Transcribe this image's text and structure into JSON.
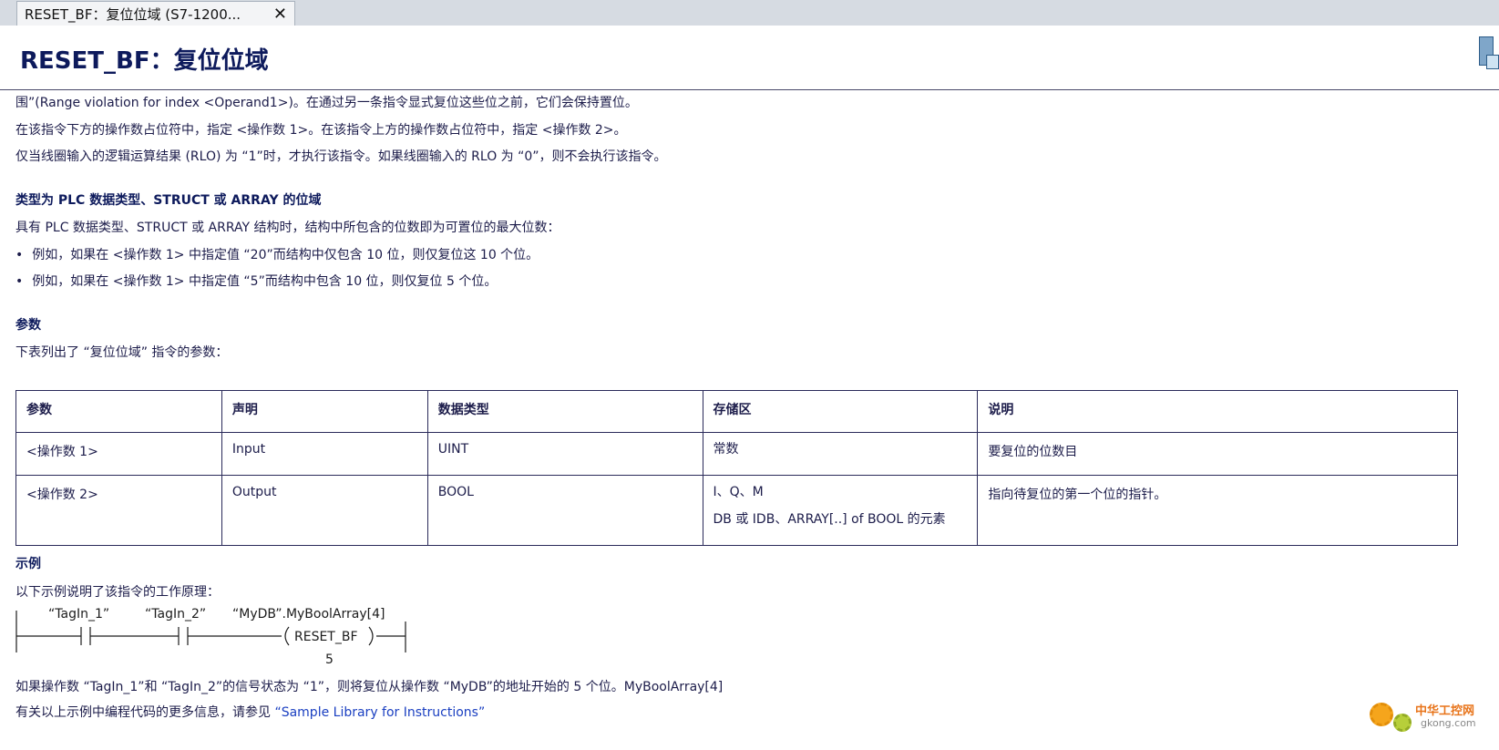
{
  "tab": {
    "label": "RESET_BF：复位位域 (S7-1200...",
    "close": "✕"
  },
  "page_title": "RESET_BF：复位位域",
  "intro_lines": [
    "围”(Range violation for index <Operand1>)。在通过另一条指令显式复位这些位之前，它们会保持置位。",
    "在该指令下方的操作数占位符中，指定 <操作数 1>。在该指令上方的操作数占位符中，指定 <操作数 2>。",
    "仅当线圈输入的逻辑运算结果 (RLO) 为 “1”时，才执行该指令。如果线圈输入的 RLO 为 “0”，则不会执行该指令。"
  ],
  "section_struct": {
    "heading": "类型为 PLC 数据类型、STRUCT 或 ARRAY 的位域",
    "text": "具有 PLC 数据类型、STRUCT 或 ARRAY 结构时，结构中所包含的位数即为可置位的最大位数：",
    "bullets": [
      "例如，如果在 <操作数 1> 中指定值 “20”而结构中仅包含 10 位，则仅复位这 10 个位。",
      "例如，如果在 <操作数 1> 中指定值 “5”而结构中包含 10 位，则仅复位 5 个位。"
    ]
  },
  "section_params": {
    "heading": "参数",
    "text": "下表列出了 “复位位域” 指令的参数："
  },
  "params_table": {
    "headers": [
      "参数",
      "声明",
      "数据类型",
      "存储区",
      "说明"
    ],
    "rows": [
      {
        "param": "<操作数 1>",
        "decl": "Input",
        "type": "UINT",
        "area": [
          "常数"
        ],
        "desc": "要复位的位数目"
      },
      {
        "param": "<操作数 2>",
        "decl": "Output",
        "type": "BOOL",
        "area": [
          "I、Q、M",
          "DB 或 IDB、ARRAY[..] of BOOL 的元素"
        ],
        "desc": "指向待复位的第一个位的指针。"
      }
    ]
  },
  "section_example": {
    "heading": "示例",
    "text": "以下示例说明了该指令的工作原理：",
    "ladder": {
      "contact1": "“TagIn_1”",
      "contact2": "“TagIn_2”",
      "coil_operand": "“MyDB”.MyBoolArray[4]",
      "coil_label": "RESET_BF",
      "count": "5"
    },
    "result_text": "如果操作数 “TagIn_1”和 “TagIn_2”的信号状态为 “1”，则将复位从操作数 “MyDB”的地址开始的 5 个位。MyBoolArray[4]",
    "more_info_prefix": "有关以上示例中编程代码的更多信息，请参见 ",
    "more_info_link": "“Sample Library for Instructions”"
  },
  "watermark": {
    "line1": "中华工控网",
    "line2": "gkong.com"
  }
}
